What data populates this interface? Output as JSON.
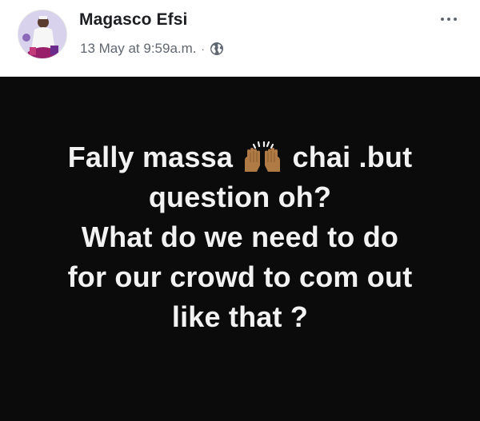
{
  "post": {
    "author": {
      "name": "Magasco Efsi",
      "avatar_icon": "profile-photo"
    },
    "timestamp": "13 May at 9:59a.m.",
    "separator": "·",
    "privacy_icon": "globe-icon",
    "more_icon": "more-options-icon",
    "background_color": "#0b0b0b",
    "text_color": "#f2f2f2",
    "content": {
      "line1_before": "Fally massa",
      "emoji": "raised-hands-emoji",
      "line1_after": "chai .but",
      "line2": "question oh?",
      "line3": "What do we need to do",
      "line4": "for our crowd to com out",
      "line5": "like that ?"
    }
  }
}
